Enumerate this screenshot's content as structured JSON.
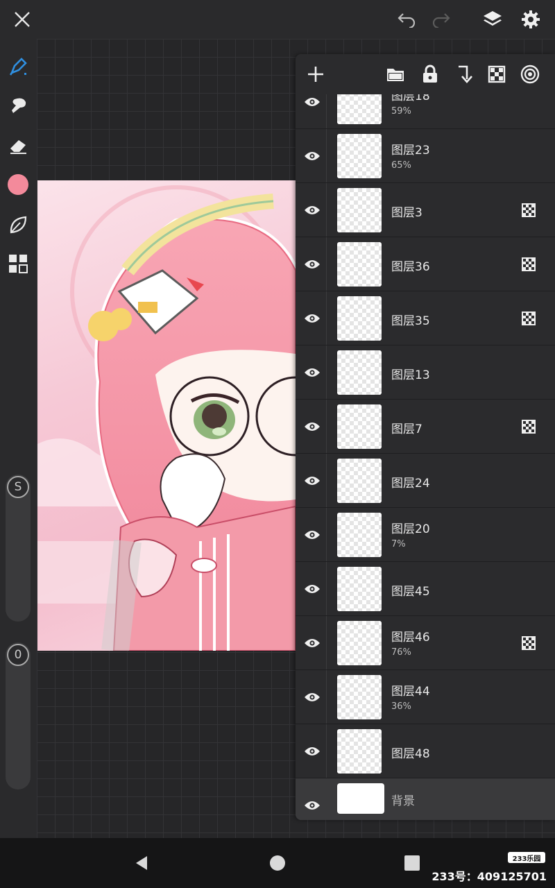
{
  "layers": [
    {
      "name": "图层18",
      "opacity": "59%",
      "clipped": false
    },
    {
      "name": "图层23",
      "opacity": "65%",
      "clipped": false
    },
    {
      "name": "图层3",
      "opacity": "",
      "clipped": true
    },
    {
      "name": "图层36",
      "opacity": "",
      "clipped": true
    },
    {
      "name": "图层35",
      "opacity": "",
      "clipped": true
    },
    {
      "name": "图层13",
      "opacity": "",
      "clipped": false
    },
    {
      "name": "图层7",
      "opacity": "",
      "clipped": true
    },
    {
      "name": "图层24",
      "opacity": "",
      "clipped": false
    },
    {
      "name": "图层20",
      "opacity": "7%",
      "clipped": false
    },
    {
      "name": "图层45",
      "opacity": "",
      "clipped": false
    },
    {
      "name": "图层46",
      "opacity": "76%",
      "clipped": true
    },
    {
      "name": "图层44",
      "opacity": "36%",
      "clipped": false
    },
    {
      "name": "图层48",
      "opacity": "",
      "clipped": false
    }
  ],
  "background_layer": {
    "name": "背景"
  },
  "sliders": {
    "size_label": "S",
    "opacity_value": "0"
  },
  "colors": {
    "current_brush": "#f38a9b",
    "accent": "#2f8fe0"
  },
  "watermark": {
    "badge": "233乐园",
    "id_text": "233号：409125701"
  }
}
